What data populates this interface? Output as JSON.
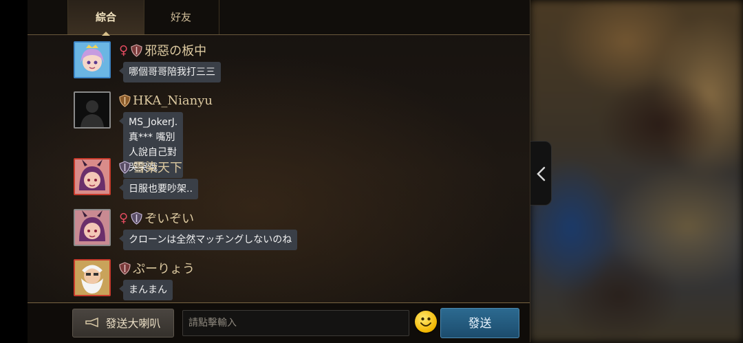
{
  "tabs": [
    {
      "label": "綜合",
      "active": true
    },
    {
      "label": "好友",
      "active": false
    }
  ],
  "messages": [
    {
      "username": "邪惡の板中",
      "female": true,
      "text": "哪個哥哥陪我打三三",
      "avatar": "pink-hair-fairy"
    },
    {
      "username": "HKA_Nianyu",
      "female": false,
      "text": "MS_JokerJ. 真*** 嘴別人說自己對",
      "text2": "哭哭哦",
      "avatar": "default-silhouette"
    },
    {
      "username": "雪染天下",
      "female": false,
      "text": "日服也要吵架..",
      "avatar": "horned-girl"
    },
    {
      "username": "ぞいぞい",
      "female": true,
      "text": "クローンは全然マッチングしないのね",
      "avatar": "horned-girl"
    },
    {
      "username": "ぷーりょう",
      "female": false,
      "text": "まんまん",
      "avatar": "white-bearded-warrior"
    }
  ],
  "bottom": {
    "horn_label": "發送大喇叭",
    "input_placeholder": "請點擊輸入",
    "send_label": "發送"
  },
  "colors": {
    "username": "#dcc9a0",
    "bubble": "#3a3f47",
    "send_button": "#1c4c6d",
    "female": "#e24b5f"
  }
}
